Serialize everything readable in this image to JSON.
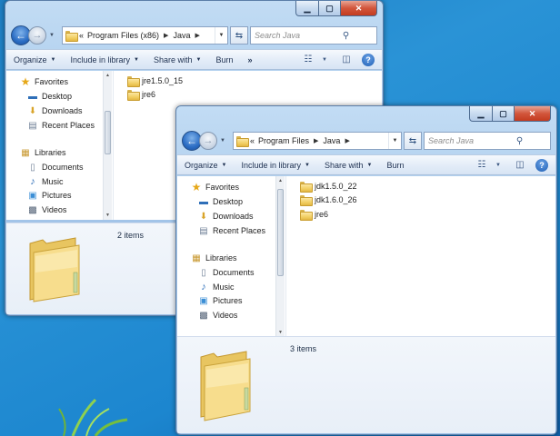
{
  "desktop": {
    "accent": "#1d7fc4"
  },
  "back_window": {
    "caption": {
      "minimize_icon": "minimize-icon",
      "maximize_icon": "maximize-icon",
      "close_icon": "close-icon"
    },
    "breadcrumb": [
      "«",
      "Program Files (x86)",
      "Java"
    ],
    "search_placeholder": "Search Java",
    "toolbar": {
      "organize": "Organize",
      "include_in_library": "Include in library",
      "share_with": "Share with",
      "burn": "Burn",
      "more": "»"
    },
    "nav": {
      "favorites": "Favorites",
      "favorites_items": [
        "Desktop",
        "Downloads",
        "Recent Places"
      ],
      "libraries": "Libraries",
      "libraries_items": [
        "Documents",
        "Music",
        "Pictures",
        "Videos"
      ]
    },
    "files": [
      "jre1.5.0_15",
      "jre6"
    ],
    "status": "2 items"
  },
  "front_window": {
    "caption": {
      "minimize_icon": "minimize-icon",
      "maximize_icon": "maximize-icon",
      "close_icon": "close-icon"
    },
    "breadcrumb": [
      "«",
      "Program Files",
      "Java"
    ],
    "search_placeholder": "Search Java",
    "toolbar": {
      "organize": "Organize",
      "include_in_library": "Include in library",
      "share_with": "Share with",
      "burn": "Burn"
    },
    "nav": {
      "favorites": "Favorites",
      "favorites_items": [
        "Desktop",
        "Downloads",
        "Recent Places"
      ],
      "libraries": "Libraries",
      "libraries_items": [
        "Documents",
        "Music",
        "Pictures",
        "Videos"
      ]
    },
    "files": [
      "jdk1.5.0_22",
      "jdk1.6.0_26",
      "jre6"
    ],
    "status": "3 items"
  }
}
